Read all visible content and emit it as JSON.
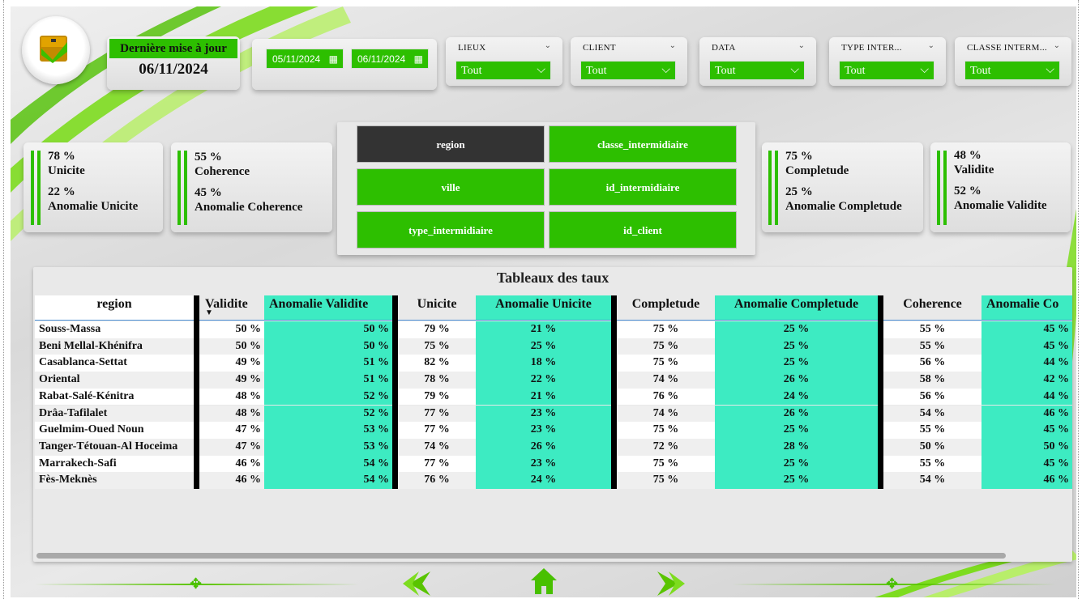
{
  "header": {
    "update_label": "Dernière mise à jour",
    "update_date": "06/11/2024",
    "date_from": "05/11/2024",
    "date_to": "06/11/2024"
  },
  "filters": [
    {
      "label": "LIEUX",
      "value": "Tout"
    },
    {
      "label": "CLIENT",
      "value": "Tout"
    },
    {
      "label": "DATA",
      "value": "Tout"
    },
    {
      "label": "TYPE INTER...",
      "value": "Tout"
    },
    {
      "label": "CLASSE INTERM...",
      "value": "Tout"
    }
  ],
  "kpis": {
    "unicite": {
      "v1": "78 %",
      "l1": "Unicite",
      "v2": "22 %",
      "l2": "Anomalie Unicite"
    },
    "coherence": {
      "v1": "55 %",
      "l1": "Coherence",
      "v2": "45 %",
      "l2": "Anomalie Coherence"
    },
    "completude": {
      "v1": "75 %",
      "l1": "Completude",
      "v2": "25 %",
      "l2": "Anomalie Completude"
    },
    "validite": {
      "v1": "48 %",
      "l1": "Validite",
      "v2": "52 %",
      "l2": "Anomalie Validite"
    }
  },
  "matrix": {
    "buttons": [
      "region",
      "classe_intermidiaire",
      "ville",
      "id_intermidiaire",
      "type_intermidiaire",
      "id_client"
    ],
    "active": "region"
  },
  "table": {
    "title": "Tableaux des taux",
    "headers": [
      "region",
      "Validite",
      "Anomalie Validite",
      "Unicite",
      "Anomalie Unicite",
      "Completude",
      "Anomalie Completude",
      "Coherence",
      "Anomalie Co"
    ],
    "rows": [
      [
        "Souss-Massa",
        "50 %",
        "50 %",
        "79 %",
        "21 %",
        "75 %",
        "25 %",
        "55 %",
        "45 %"
      ],
      [
        "Beni Mellal-Khénifra",
        "50 %",
        "50 %",
        "75 %",
        "25 %",
        "75 %",
        "25 %",
        "55 %",
        "45 %"
      ],
      [
        "Casablanca-Settat",
        "49 %",
        "51 %",
        "82 %",
        "18 %",
        "75 %",
        "25 %",
        "56 %",
        "44 %"
      ],
      [
        "Oriental",
        "49 %",
        "51 %",
        "78 %",
        "22 %",
        "74 %",
        "26 %",
        "58 %",
        "42 %"
      ],
      [
        "Rabat-Salé-Kénitra",
        "48 %",
        "52 %",
        "79 %",
        "21 %",
        "76 %",
        "24 %",
        "56 %",
        "44 %"
      ],
      [
        "Drâa-Tafilalet",
        "48 %",
        "52 %",
        "77 %",
        "23 %",
        "74 %",
        "26 %",
        "54 %",
        "46 %"
      ],
      [
        "Guelmim-Oued Noun",
        "47 %",
        "53 %",
        "77 %",
        "23 %",
        "75 %",
        "25 %",
        "55 %",
        "45 %"
      ],
      [
        "Tanger-Tétouan-Al Hoceima",
        "47 %",
        "53 %",
        "74 %",
        "26 %",
        "72 %",
        "28 %",
        "50 %",
        "50 %"
      ],
      [
        "Marrakech-Safi",
        "46 %",
        "54 %",
        "77 %",
        "23 %",
        "75 %",
        "25 %",
        "55 %",
        "45 %"
      ],
      [
        "Fès-Meknès",
        "46 %",
        "54 %",
        "76 %",
        "24 %",
        "75 %",
        "25 %",
        "54 %",
        "46 %"
      ]
    ]
  },
  "icons": {
    "calendar": "calendar-icon",
    "prev": "arrow-left-icon",
    "home": "home-icon",
    "next": "arrow-right-icon"
  },
  "colors": {
    "accent": "#2dbf00",
    "teal": "#3debc2",
    "active": "#333333"
  }
}
